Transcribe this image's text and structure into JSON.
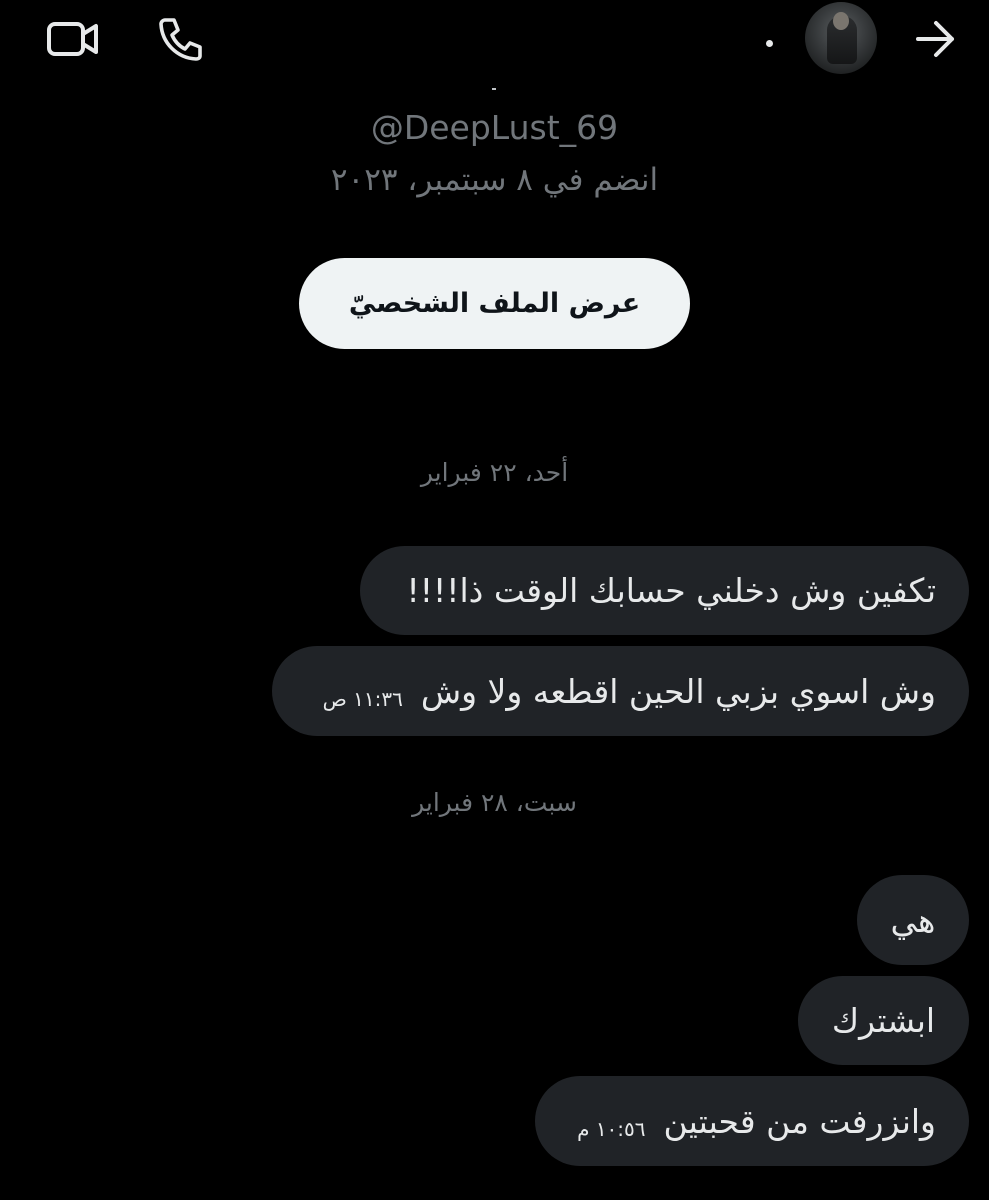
{
  "header": {
    "video_icon": "video-camera-icon",
    "phone_icon": "phone-icon",
    "back_icon": "arrow-right-icon",
    "avatar": "avatar"
  },
  "profile": {
    "handle": "@DeepLust_69",
    "joined": "انضم في ٨ سبتمبر، ٢٠٢٣",
    "view_profile_label": "عرض الملف الشخصيّ"
  },
  "conversation": {
    "days": [
      {
        "label": "أحد، ٢٢ فبراير",
        "messages": [
          {
            "text": "تكفين وش دخلني حسابك الوقت ذا!!!!",
            "time": ""
          },
          {
            "text": "وش اسوي بزبي الحين اقطعه ولا وش",
            "time": "١١:٣٦ ص"
          }
        ]
      },
      {
        "label": "سبت، ٢٨ فبراير",
        "messages": [
          {
            "text": "هي",
            "time": ""
          },
          {
            "text": "ابشترك",
            "time": ""
          },
          {
            "text": "وانزرفت من قحبتين",
            "time": "١٠:٥٦ م"
          }
        ]
      }
    ]
  },
  "colors": {
    "background": "#000000",
    "bubble": "#202327",
    "muted_text": "#71767b",
    "primary_text": "#e7e9ea",
    "button_bg": "#eff3f4"
  }
}
